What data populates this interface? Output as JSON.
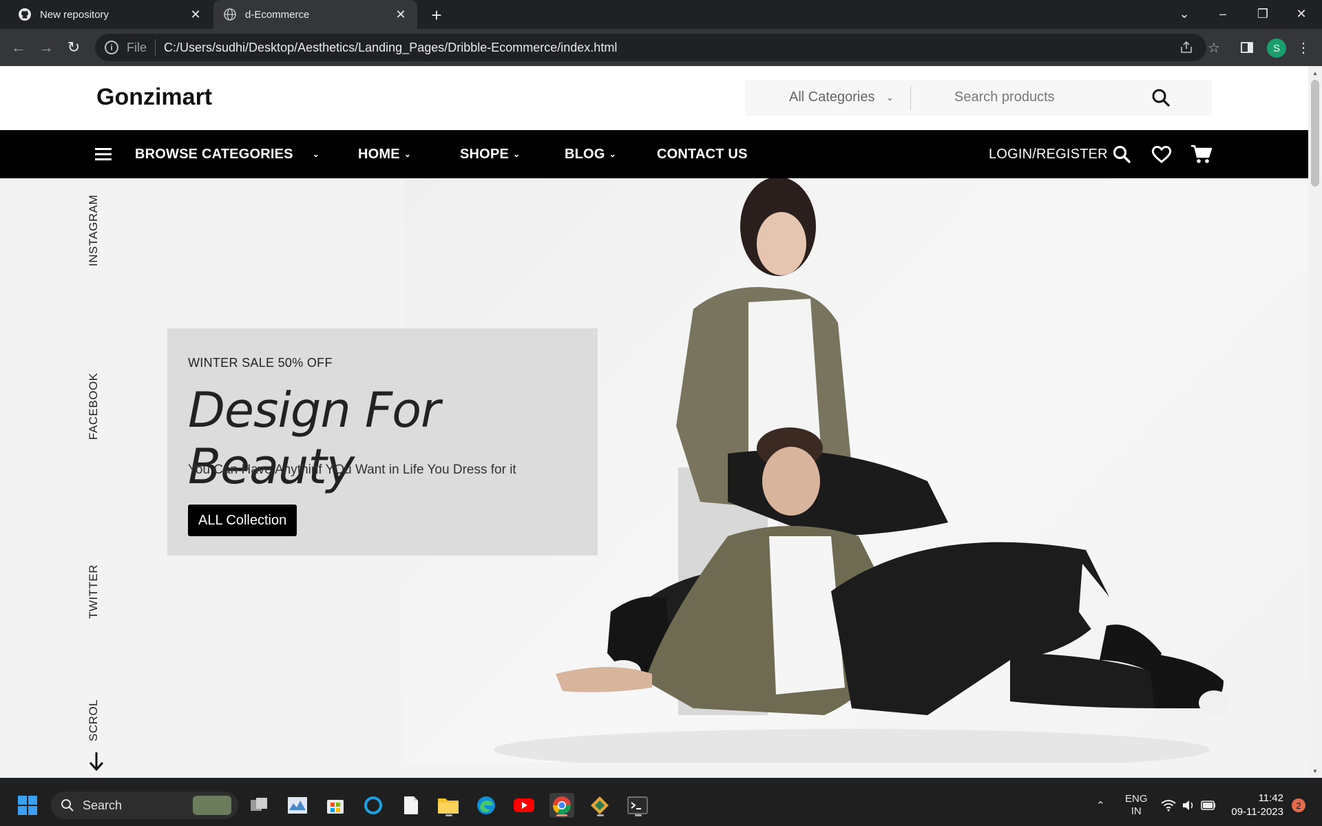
{
  "browser": {
    "tabs": [
      {
        "title": "New repository",
        "icon": "github-icon"
      },
      {
        "title": "d-Ecommerce",
        "icon": "globe-icon"
      }
    ],
    "scheme_label": "File",
    "url": "C:/Users/sudhi/Desktop/Aesthetics/Landing_Pages/Dribble-Ecommerce/index.html",
    "profile_initial": "S"
  },
  "header": {
    "logo": "Gonzimart",
    "category_select": "All Categories",
    "search_placeholder": "Search products"
  },
  "nav": {
    "browse_categories": "BROWSE CATEGORIES",
    "items": [
      {
        "label": "HOME"
      },
      {
        "label": "SHOPE"
      },
      {
        "label": "BLOG"
      },
      {
        "label": "CONTACT US"
      }
    ],
    "login": "LOGIN/REGISTER"
  },
  "social": [
    "INSTAGRAM",
    "FACEBOOK",
    "TWITTER",
    "SCROL"
  ],
  "hero": {
    "kicker": "WINTER SALE 50% OFF",
    "headline": "Design For Beauty",
    "subtext": "You Can Have Anythinf YOu Want in Life You Dress for it",
    "cta": "ALL Collection"
  },
  "taskbar": {
    "search_label": "Search",
    "lang_line1": "ENG",
    "lang_line2": "IN",
    "time": "11:42",
    "date": "09-11-2023",
    "notification_count": "2"
  },
  "colors": {
    "navbar": "#000000",
    "promo_panel": "#dcdcdc",
    "hero_bg": "#f3f3f3"
  }
}
